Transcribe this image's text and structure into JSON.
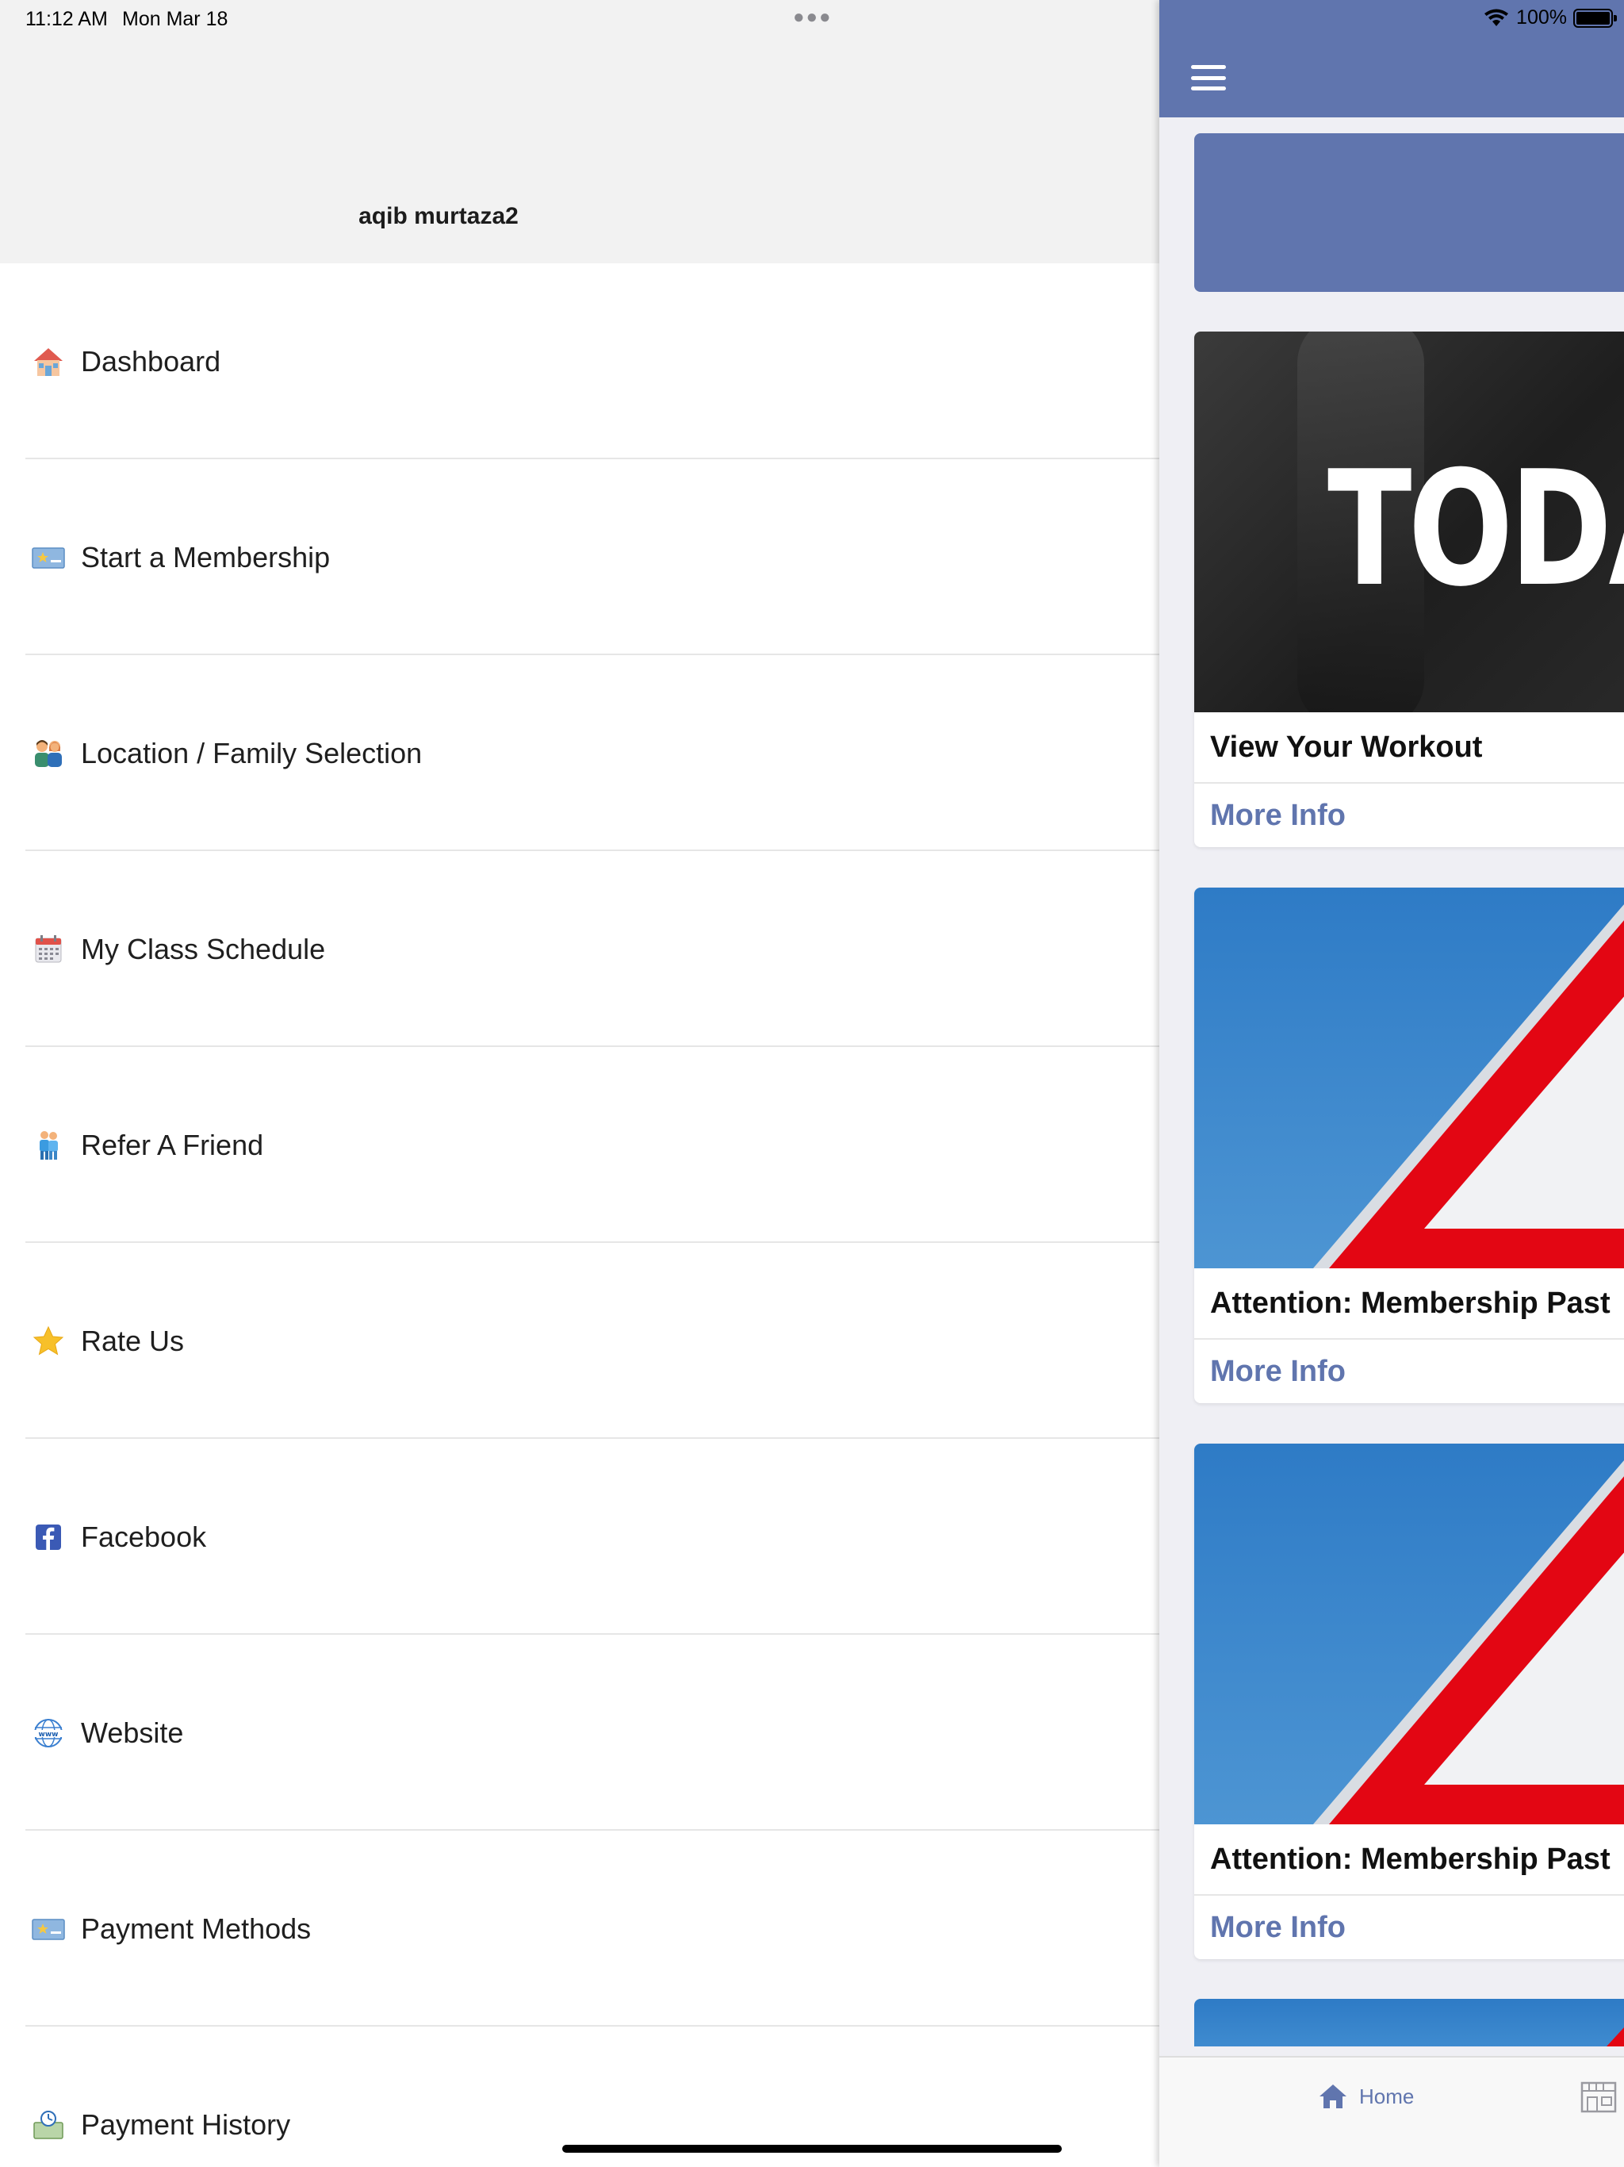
{
  "status_bar": {
    "time": "11:12 AM",
    "date": "Mon Mar 18",
    "battery": "100%"
  },
  "drawer": {
    "profile_name": "aqib murtaza2",
    "items": [
      {
        "label": "Dashboard",
        "icon": "house-icon"
      },
      {
        "label": "Start a Membership",
        "icon": "membership-card-icon"
      },
      {
        "label": "Location / Family Selection",
        "icon": "family-icon"
      },
      {
        "label": "My Class Schedule",
        "icon": "calendar-icon"
      },
      {
        "label": "Refer A Friend",
        "icon": "friends-icon"
      },
      {
        "label": "Rate Us",
        "icon": "star-icon"
      },
      {
        "label": "Facebook",
        "icon": "facebook-icon"
      },
      {
        "label": "Website",
        "icon": "globe-icon"
      },
      {
        "label": "Payment Methods",
        "icon": "payment-card-icon"
      },
      {
        "label": "Payment History",
        "icon": "payment-history-icon"
      }
    ]
  },
  "main": {
    "nav_icon": "hamburger-menu-icon",
    "cards": [
      {
        "title": "View Your Workout",
        "link": "More Info",
        "image_text": "TODA"
      },
      {
        "title": "Attention: Membership Past",
        "link": "More Info"
      },
      {
        "title": "Attention: Membership Past",
        "link": "More Info"
      }
    ],
    "tab_bar": {
      "home_label": "Home"
    }
  },
  "colors": {
    "accent": "#6075ae",
    "drawer_header": "#f2f2f2",
    "warning_red": "#e30613",
    "sky_blue": "#2e7bc6"
  }
}
